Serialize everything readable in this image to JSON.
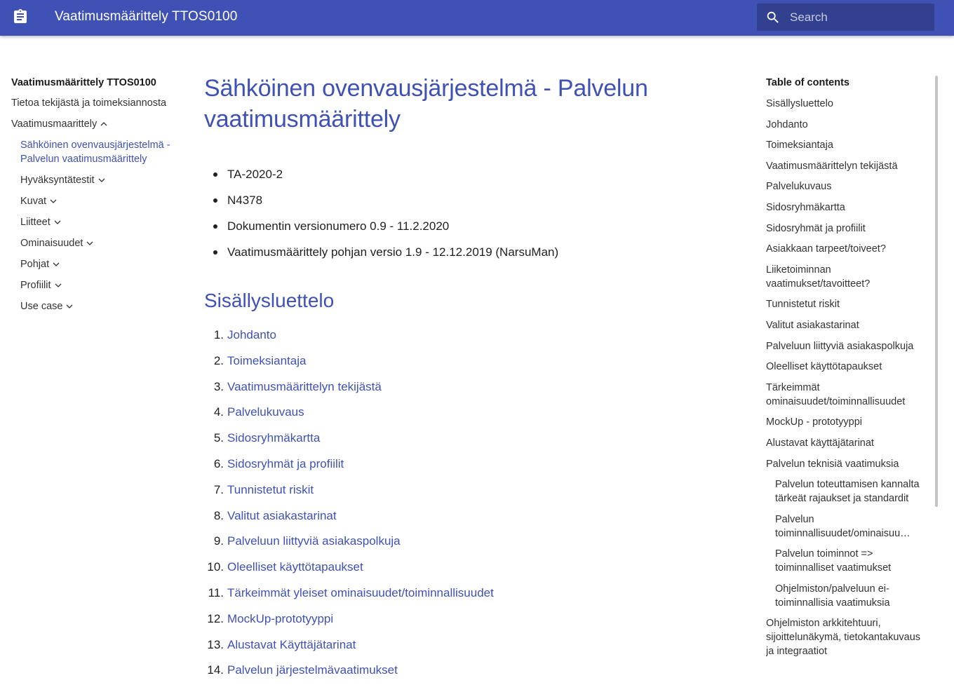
{
  "header": {
    "site_title": "Vaatimusmäärittely TTOS0100",
    "search_placeholder": "Search",
    "colors": {
      "primary": "#3f51b5",
      "search_bg": "#32418f"
    },
    "icons": {
      "logo": "clipboard-icon",
      "search": "search-icon"
    }
  },
  "nav": {
    "title": "Vaatimusmäärittely TTOS0100",
    "items": [
      {
        "label": "Tietoa tekijästä ja toimeksiannosta"
      },
      {
        "label": "Vaatimusmaarittely",
        "chevron": "up"
      }
    ],
    "active": "Sähköinen ovenvausjärjestelmä - Palvelun vaatimusmäärittely",
    "sub_items": [
      {
        "label": "Hyväksyntätestit"
      },
      {
        "label": "Kuvat"
      },
      {
        "label": "Liitteet"
      },
      {
        "label": "Ominaisuudet"
      },
      {
        "label": "Pohjat"
      },
      {
        "label": "Profiilit"
      },
      {
        "label": "Use case"
      }
    ]
  },
  "main": {
    "title": "Sähköinen ovenvausjärjestelmä - Palvelun vaatimusmäärittely",
    "meta": [
      "TA-2020-2",
      "N4378",
      "Dokumentin versionumero 0.9 - 11.2.2020",
      "Vaatimusmäärittely pohjan versio 1.9 - 12.12.2019 (NarsuMan)"
    ],
    "contents_heading": "Sisällysluettelo",
    "contents": [
      {
        "num": "1.",
        "label": "Johdanto"
      },
      {
        "num": "2.",
        "label": "Toimeksiantaja"
      },
      {
        "num": "3.",
        "label": "Vaatimusmäärittelyn tekijästä"
      },
      {
        "num": "4.",
        "label": "Palvelukuvaus"
      },
      {
        "num": "5.",
        "label": "Sidosryhmäkartta"
      },
      {
        "num": "6.",
        "label": "Sidosryhmät ja profiilit"
      },
      {
        "num": "7.",
        "label": "Tunnistetut riskit"
      },
      {
        "num": "8.",
        "label": "Valitut asiakastarinat"
      },
      {
        "num": "9.",
        "label": "Palveluun liittyviä asiakaspolkuja"
      },
      {
        "num": "10.",
        "label": "Oleelliset käyttötapaukset"
      },
      {
        "num": "11.",
        "label": "Tärkeimmät yleiset ominaisuudet/toiminnallisuudet"
      },
      {
        "num": "12.",
        "label": "MockUp-prototyyppi"
      },
      {
        "num": "13.",
        "label": "Alustavat Käyttäjätarinat"
      },
      {
        "num": "14.",
        "label": "Palvelun järjestelmävaatimukset"
      }
    ]
  },
  "toc": {
    "title": "Table of contents",
    "items": [
      {
        "label": "Sisällysluettelo"
      },
      {
        "label": "Johdanto"
      },
      {
        "label": "Toimeksiantaja"
      },
      {
        "label": "Vaatimusmäärittelyn tekijästä"
      },
      {
        "label": "Palvelukuvaus"
      },
      {
        "label": "Sidosryhmäkartta"
      },
      {
        "label": "Sidosryhmät ja profiilit"
      },
      {
        "label": "Asiakkaan tarpeet/toiveet?"
      },
      {
        "label": "Liiketoiminnan vaatimukset/tavoitteet?"
      },
      {
        "label": "Tunnistetut riskit"
      },
      {
        "label": "Valitut asiakastarinat"
      },
      {
        "label": "Palveluun liittyviä asiakaspolkuja"
      },
      {
        "label": "Oleelliset käyttötapaukset"
      },
      {
        "label": "Tärkeimmät ominaisuudet/toiminnallisuudet"
      },
      {
        "label": "MockUp - prototyyppi"
      },
      {
        "label": "Alustavat käyttäjätarinat"
      },
      {
        "label": "Palvelun teknisiä vaatimuksia"
      }
    ],
    "sub_items": [
      {
        "label": "Palvelun toteuttamisen kannalta tärkeät rajaukset ja standardit"
      },
      {
        "label": "Palvelun toiminnallisuudet/ominaisuu…"
      },
      {
        "label": "Palvelun toiminnot => toiminnalliset vaatimukset"
      },
      {
        "label": "Ohjelmiston/palveluun ei-toiminnallisia vaatimuksia"
      }
    ],
    "last_item": "Ohjelmiston arkkitehtuuri, sijoittelunäkymä, tietokantakuvaus ja integraatiot"
  }
}
